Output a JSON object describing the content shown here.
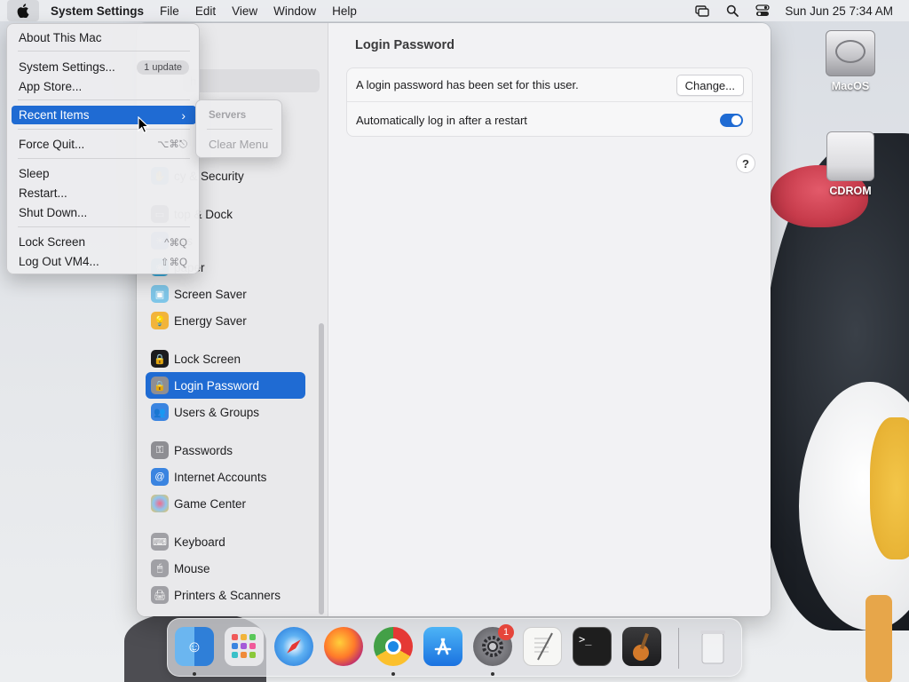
{
  "menubar": {
    "app_name": "System Settings",
    "menus": [
      "File",
      "Edit",
      "View",
      "Window",
      "Help"
    ],
    "clock": "Sun Jun 25  7:34 AM"
  },
  "apple_menu": {
    "items": [
      {
        "label": "About This Mac"
      },
      {
        "label": "System Settings...",
        "badge": "1 update"
      },
      {
        "label": "App Store..."
      },
      {
        "label": "Recent Items"
      },
      {
        "label": "Force Quit...",
        "shortcut": "⌥⌘⎋"
      },
      {
        "label": "Sleep"
      },
      {
        "label": "Restart..."
      },
      {
        "label": "Shut Down..."
      },
      {
        "label": "Lock Screen",
        "shortcut": "^⌘Q"
      },
      {
        "label": "Log Out VM4...",
        "shortcut": "⇧⌘Q"
      }
    ]
  },
  "recent_submenu": {
    "header": "Servers",
    "clear": "Clear Menu"
  },
  "sidebar": {
    "search_placeholder": "Search",
    "items": [
      {
        "label": "Privacy & Security",
        "visible": "cy & Security"
      },
      {
        "label": "Desktop & Dock",
        "visible": "top & Dock"
      },
      {
        "label": "Displays",
        "visible": "ays"
      },
      {
        "label": "Wallpaper",
        "visible": "paper"
      },
      {
        "label": "Screen Saver"
      },
      {
        "label": "Energy Saver"
      },
      {
        "label": "Lock Screen"
      },
      {
        "label": "Login Password"
      },
      {
        "label": "Users & Groups"
      },
      {
        "label": "Passwords"
      },
      {
        "label": "Internet Accounts"
      },
      {
        "label": "Game Center"
      },
      {
        "label": "Keyboard"
      },
      {
        "label": "Mouse"
      },
      {
        "label": "Printers & Scanners"
      }
    ]
  },
  "content": {
    "title": "Login Password",
    "row1_text": "A login password has been set for this user.",
    "change_button": "Change...",
    "row2_text": "Automatically log in after a restart",
    "auto_login_enabled": true,
    "help": "?"
  },
  "desktop": {
    "icons": [
      {
        "label": "MacOS"
      },
      {
        "label": "CDROM"
      }
    ]
  },
  "dock": {
    "apps": [
      "Finder",
      "Launchpad",
      "Safari",
      "Firefox",
      "Chrome",
      "App Store",
      "System Settings",
      "TextEdit",
      "Terminal",
      "GarageBand",
      "Trash"
    ],
    "settings_badge": "1"
  },
  "colors": {
    "accent": "#1f6bd3",
    "badge": "#e5453b"
  }
}
